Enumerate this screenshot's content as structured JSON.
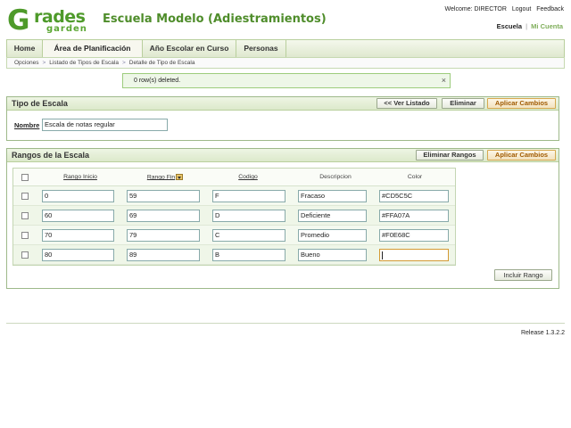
{
  "app": {
    "logo_text_main": "rades",
    "logo_text_letter": "G",
    "logo_text_sub": "garden",
    "school_name": "Escuela Modelo (Adiestramientos)"
  },
  "user_bar": {
    "welcome": "Welcome: DIRECTOR",
    "logout": "Logout",
    "feedback": "Feedback"
  },
  "context": {
    "active": "Escuela",
    "separator": "|",
    "alt": "Mi Cuenta"
  },
  "nav": {
    "tabs": [
      {
        "label": "Home"
      },
      {
        "label": "Área de Planificación"
      },
      {
        "label": "Año Escolar en Curso"
      },
      {
        "label": "Personas"
      }
    ]
  },
  "breadcrumb": {
    "items": [
      "Opciones",
      "Listado de Tipos de Escala",
      "Detalle de Tipo de Escala"
    ],
    "sep": ">"
  },
  "notice": {
    "text": "0 row(s) deleted.",
    "close": "×"
  },
  "tipo_panel": {
    "title": "Tipo de Escala",
    "back_label": "<< Ver Listado",
    "delete_label": "Eliminar",
    "apply_label": "Aplicar Cambios",
    "name_label": "Nombre",
    "name_value": "Escala de notas regular"
  },
  "rangos_panel": {
    "title": "Rangos de la Escala",
    "delete_label": "Eliminar Rangos",
    "apply_label": "Aplicar Cambios",
    "include_label": "Incluir Rango",
    "columns": {
      "inicio": "Rango Inicio",
      "fin": "Rango Fin",
      "codigo": "Codigo",
      "descripcion": "Descripcion",
      "color": "Color"
    },
    "rows": [
      {
        "inicio": "0",
        "fin": "59",
        "codigo": "F",
        "descripcion": "Fracaso",
        "color": "#CD5C5C"
      },
      {
        "inicio": "60",
        "fin": "69",
        "codigo": "D",
        "descripcion": "Deficiente",
        "color": "#FFA07A"
      },
      {
        "inicio": "70",
        "fin": "79",
        "codigo": "C",
        "descripcion": "Promedio",
        "color": "#F0E68C"
      },
      {
        "inicio": "80",
        "fin": "89",
        "codigo": "B",
        "descripcion": "Bueno",
        "color": ""
      }
    ]
  },
  "footer": {
    "release": "Release 1.3.2.2"
  },
  "theme": {
    "brand_green": "#4e9a2a",
    "accent_orange": "#d6a84e"
  }
}
